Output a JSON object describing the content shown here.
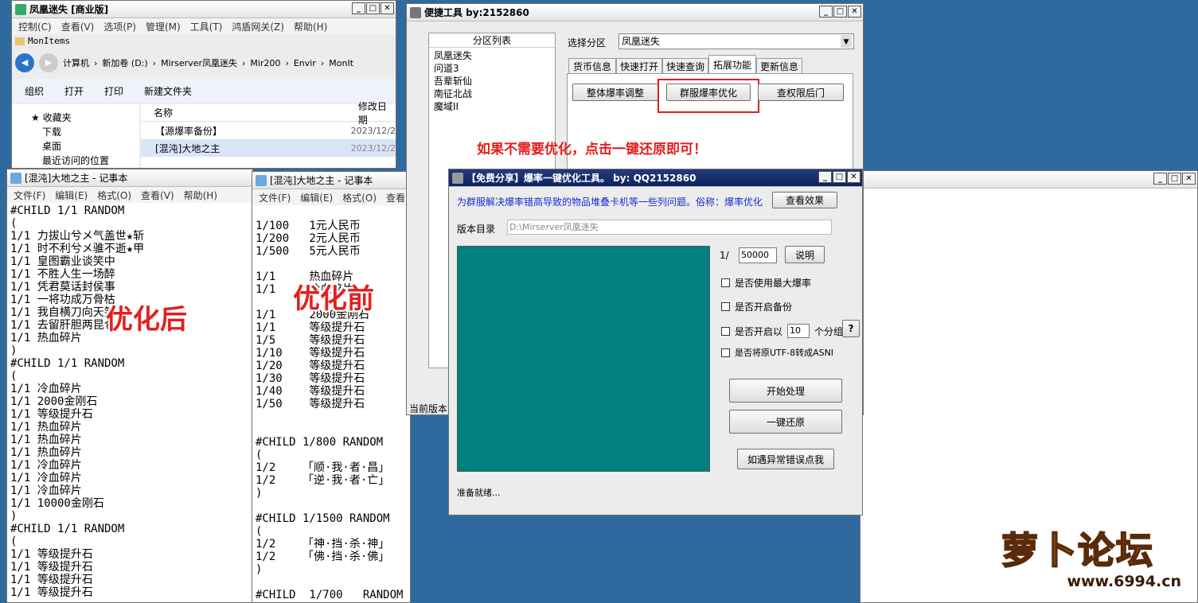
{
  "explorer": {
    "title": "凤凰迷失 [商业版]",
    "menu": [
      "控制(C)",
      "查看(V)",
      "选项(P)",
      "管理(M)",
      "工具(T)",
      "鸿盾网关(Z)",
      "帮助(H)"
    ],
    "subtitle": "MonItems",
    "path": [
      "计算机",
      "新加卷 (D:)",
      "Mirserver凤凰迷失",
      "Mir200",
      "Envir",
      "MonIt"
    ],
    "toolbar": [
      "组织",
      "打开",
      "打印",
      "新建文件夹"
    ],
    "nav": [
      "收藏夹",
      "下载",
      "桌面",
      "最近访问的位置"
    ],
    "col_name": "名称",
    "col_date": "修改日期",
    "files": [
      {
        "name": "【源爆率备份】",
        "date": "2023/12/2"
      },
      {
        "name": "[混沌]大地之主",
        "date": "2023/12/2"
      }
    ]
  },
  "np1": {
    "title": "[混沌]大地之主 - 记事本",
    "menu": [
      "文件(F)",
      "编辑(E)",
      "格式(O)",
      "查看(V)",
      "帮助(H)"
    ],
    "text": "#CHILD 1/1 RANDOM\n(\n1/1 力拔山兮メ气盖世★斩\n1/1 时不利兮メ骓不逝★甲\n1/1 皇图霸业谈笑中\n1/1 不胜人生一场醉\n1/1 凭君莫话封侯事\n1/1 一将功成万骨枯\n1/1 我自横刀向天笑\n1/1 去留肝胆两昆仑\n1/1 热血碎片\n)\n#CHILD 1/1 RANDOM\n(\n1/1 冷血碎片\n1/1 2000金刚石\n1/1 等级提升石\n1/1 热血碎片\n1/1 热血碎片\n1/1 热血碎片\n1/1 冷血碎片\n1/1 冷血碎片\n1/1 冷血碎片\n1/1 10000金刚石\n)\n#CHILD 1/1 RANDOM\n(\n1/1 等级提升石\n1/1 等级提升石\n1/1 等级提升石\n1/1 等级提升石",
    "label": "优化后"
  },
  "np2": {
    "title": "[混沌]大地之主 - 记事本",
    "menu": [
      "文件(F)",
      "编辑(E)",
      "格式(O)",
      "查看"
    ],
    "text": "\n1/100   1元人民币\n1/200   2元人民币\n1/500   5元人民币\n\n1/1     热血碎片\n1/1     冷血碎片\n\n1/1     2000金刚石\n1/1     等级提升石\n1/5     等级提升石\n1/10    等级提升石\n1/20    等级提升石\n1/30    等级提升石\n1/40    等级提升石\n1/50    等级提升石\n\n\n#CHILD 1/800 RANDOM\n(\n1/2    「顺·我·者·昌」\n1/2    「逆·我·者·亡」\n)\n\n#CHILD 1/1500 RANDOM\n(\n1/2    「神·挡·杀·神」\n1/2    「佛·挡·杀·佛」\n)\n\n#CHILD  1/700   RANDOM",
    "label": "优化前"
  },
  "quick": {
    "title": "便捷工具  by:2152860",
    "list_header": "分区列表",
    "partitions": [
      "凤凰迷失",
      "问道3",
      "吾辈斩仙",
      "南征北战",
      "魔域II"
    ],
    "select_label": "选择分区",
    "select_value": "凤凰迷失",
    "tabs": [
      "货币信息",
      "快速打开",
      "快速查询",
      "拓展功能",
      "更新信息"
    ],
    "btns": [
      "整体爆率调整",
      "群服爆率优化",
      "查权限后门"
    ],
    "status": "当前版本",
    "note": "如果不需要优化，点击一键还原即可！"
  },
  "tool": {
    "title": "【免费分享】爆率一键优化工具。   by: QQ2152860",
    "desc": "为群服解决爆率错高导致的物品堆叠卡机等一些列问题。俗称：爆率优化",
    "view_btn": "查看效果",
    "dir_label": "版本目录",
    "dir_value": "D:\\Mirserver凤凰迷失",
    "ratio_prefix": "1/",
    "ratio_value": "50000",
    "explain_btn": "说明",
    "chk1": "是否使用最大爆率",
    "chk2": "是否开启备份",
    "chk3a": "是否开启以",
    "chk3v": "10",
    "chk3b": "个分组",
    "help_btn": "?",
    "chk4": "是否将原UTF-8转成ASNI",
    "start_btn": "开始处理",
    "restore_btn": "一键还原",
    "error_btn": "如遇异常错误点我",
    "status": "准备就绪..."
  },
  "watermark": {
    "text": "萝卜论坛",
    "url": "www.6994.cn"
  },
  "colors": {
    "teal": "#008080",
    "red": "#e2201e"
  }
}
